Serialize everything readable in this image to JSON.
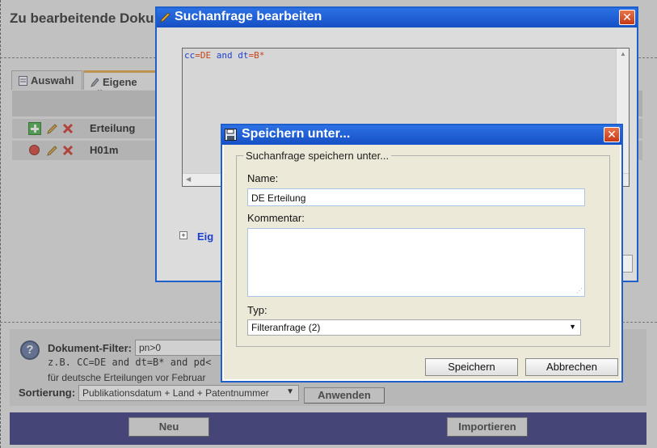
{
  "background": {
    "page_title": "Zu bearbeitende Doku",
    "tabs": [
      {
        "label": "Auswahl",
        "icon": "document-icon"
      },
      {
        "label": "Eigene Fil",
        "icon": "pencil-icon"
      }
    ],
    "rows": [
      {
        "name": "Erteilung",
        "icons": [
          "add-icon",
          "pencil-icon",
          "delete-icon"
        ]
      },
      {
        "name": "H01m",
        "icons": [
          "record-icon",
          "pencil-icon",
          "delete-icon"
        ]
      }
    ],
    "filter": {
      "label": "Dokument-Filter:",
      "value": "pn>0",
      "example": "z.B. CC=DE and dt=B* and pd<",
      "example_note": "für deutsche Erteilungen vor Februar"
    },
    "sort": {
      "label": "Sortierung:",
      "value": "Publikationsdatum + Land + Patentnummer",
      "apply_button": "Anwenden"
    },
    "buttons": {
      "new": "Neu",
      "import": "Importieren"
    }
  },
  "dialog_query": {
    "title": "Suchanfrage bearbeiten",
    "query_parts": [
      {
        "text": "cc",
        "color": "#1c3fd1"
      },
      {
        "text": "=",
        "color": "#c7441a"
      },
      {
        "text": "DE",
        "color": "#c7441a"
      },
      {
        "text": " and ",
        "color": "#1c3fd1"
      },
      {
        "text": "dt",
        "color": "#1c3fd1"
      },
      {
        "text": "=",
        "color": "#c7441a"
      },
      {
        "text": "B*",
        "color": "#c7441a"
      }
    ],
    "expander_label": "Eig"
  },
  "dialog_save": {
    "title": "Speichern unter...",
    "group_legend": "Suchanfrage speichern unter...",
    "name_label": "Name:",
    "name_value": "DE Erteilung",
    "comment_label": "Kommentar:",
    "comment_value": "",
    "type_label": "Typ:",
    "type_value": "Filteranfrage (2)",
    "save_button": "Speichern",
    "cancel_button": "Abbrechen"
  },
  "colors": {
    "title_bar": "#1f5fcc",
    "bottom_bar": "#2a2a79",
    "close_button": "#d24a20"
  }
}
